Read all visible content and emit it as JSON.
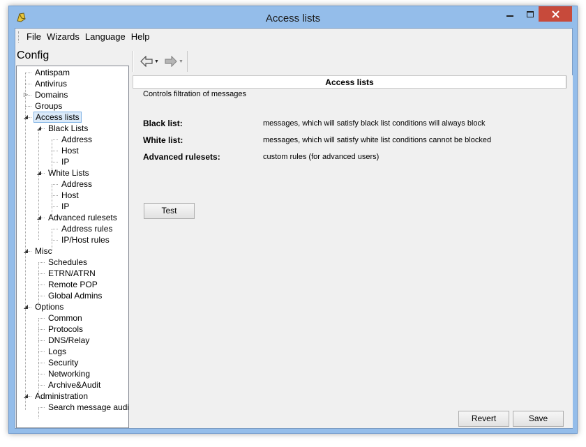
{
  "window": {
    "title": "Access lists"
  },
  "menu": [
    "File",
    "Wizards",
    "Language",
    "Help"
  ],
  "sidebar": {
    "title": "Config",
    "tree": [
      {
        "label": "Antispam",
        "level": 0,
        "expander": ""
      },
      {
        "label": "Antivirus",
        "level": 0,
        "expander": ""
      },
      {
        "label": "Domains",
        "level": 0,
        "expander": "collapsed"
      },
      {
        "label": "Groups",
        "level": 0,
        "expander": ""
      },
      {
        "label": "Access lists",
        "level": 0,
        "expander": "expanded",
        "selected": true
      },
      {
        "label": "Black Lists",
        "level": 1,
        "expander": "expanded"
      },
      {
        "label": "Address",
        "level": 2,
        "expander": ""
      },
      {
        "label": "Host",
        "level": 2,
        "expander": ""
      },
      {
        "label": "IP",
        "level": 2,
        "expander": ""
      },
      {
        "label": "White Lists",
        "level": 1,
        "expander": "expanded"
      },
      {
        "label": "Address",
        "level": 2,
        "expander": ""
      },
      {
        "label": "Host",
        "level": 2,
        "expander": ""
      },
      {
        "label": "IP",
        "level": 2,
        "expander": ""
      },
      {
        "label": "Advanced rulesets",
        "level": 1,
        "expander": "expanded"
      },
      {
        "label": "Address rules",
        "level": 2,
        "expander": ""
      },
      {
        "label": "IP/Host rules",
        "level": 2,
        "expander": ""
      },
      {
        "label": "Misc",
        "level": 0,
        "expander": "expanded"
      },
      {
        "label": "Schedules",
        "level": 1,
        "expander": ""
      },
      {
        "label": "ETRN/ATRN",
        "level": 1,
        "expander": ""
      },
      {
        "label": "Remote POP",
        "level": 1,
        "expander": ""
      },
      {
        "label": "Global Admins",
        "level": 1,
        "expander": ""
      },
      {
        "label": "Options",
        "level": 0,
        "expander": "expanded"
      },
      {
        "label": "Common",
        "level": 1,
        "expander": ""
      },
      {
        "label": "Protocols",
        "level": 1,
        "expander": ""
      },
      {
        "label": "DNS/Relay",
        "level": 1,
        "expander": ""
      },
      {
        "label": "Logs",
        "level": 1,
        "expander": ""
      },
      {
        "label": "Security",
        "level": 1,
        "expander": ""
      },
      {
        "label": "Networking",
        "level": 1,
        "expander": ""
      },
      {
        "label": "Archive&Audit",
        "level": 1,
        "expander": ""
      },
      {
        "label": "Administration",
        "level": 0,
        "expander": "expanded"
      },
      {
        "label": "Search message audit",
        "level": 1,
        "expander": ""
      }
    ]
  },
  "toolbar": {
    "back_icon": "back-arrow-icon",
    "forward_icon": "forward-arrow-icon"
  },
  "main": {
    "header": "Access lists",
    "description": "Controls filtration of messages",
    "rows": [
      {
        "label": "Black list:",
        "text": "messages, which will satisfy black list conditions will always block"
      },
      {
        "label": "White list:",
        "text": "messages, which will satisfy white list conditions cannot be blocked"
      },
      {
        "label": "Advanced rulesets:",
        "text": "custom rules (for advanced users)"
      }
    ],
    "test_label": "Test",
    "revert_label": "Revert",
    "save_label": "Save"
  },
  "colors": {
    "titlebar": "#94bdea",
    "close_button": "#c74a3b",
    "selection": "#dbeaf9"
  }
}
